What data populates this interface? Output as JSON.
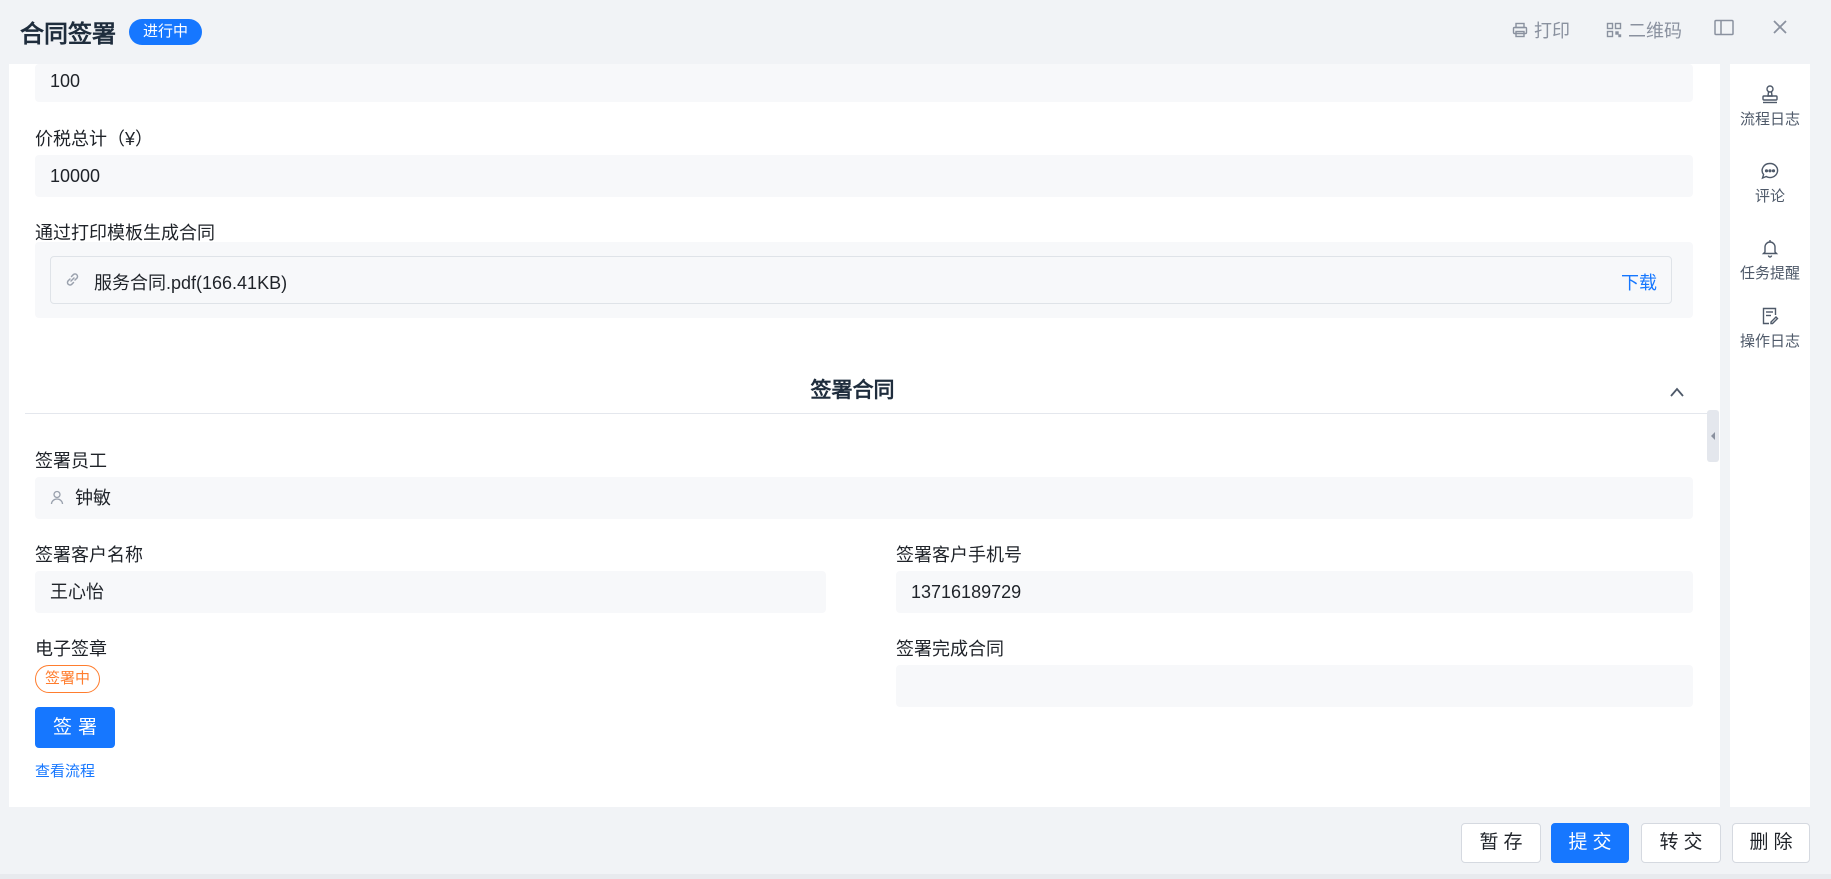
{
  "header": {
    "title": "合同签署",
    "status_badge": "进行中",
    "actions": {
      "print": "打印",
      "qrcode": "二维码"
    }
  },
  "form": {
    "quantity_value": "100",
    "total_label": "价税总计（¥）",
    "total_value": "10000",
    "template_label": "通过打印模板生成合同",
    "attachment": {
      "name": "服务合同.pdf(166.41KB)",
      "download": "下载"
    }
  },
  "signing_section": {
    "title": "签署合同",
    "employee_label": "签署员工",
    "employee_value": "钟敏",
    "customer_name_label": "签署客户名称",
    "customer_name_value": "王心怡",
    "customer_phone_label": "签署客户手机号",
    "customer_phone_value": "13716189729",
    "seal_label": "电子签章",
    "seal_status": "签署中",
    "sign_button": "签署",
    "view_flow": "查看流程",
    "completed_label": "签署完成合同",
    "completed_value": ""
  },
  "sidebar": {
    "items": [
      {
        "label": "流程日志",
        "icon": "stamp-icon"
      },
      {
        "label": "评论",
        "icon": "comment-icon"
      },
      {
        "label": "任务提醒",
        "icon": "bell-icon"
      },
      {
        "label": "操作日志",
        "icon": "log-icon"
      }
    ]
  },
  "footer": {
    "save_draft": "暂存",
    "submit": "提交",
    "transfer": "转交",
    "delete": "删除"
  },
  "colors": {
    "primary": "#1677ff",
    "warning": "#ff7d2e",
    "background": "#f1f3f6"
  }
}
